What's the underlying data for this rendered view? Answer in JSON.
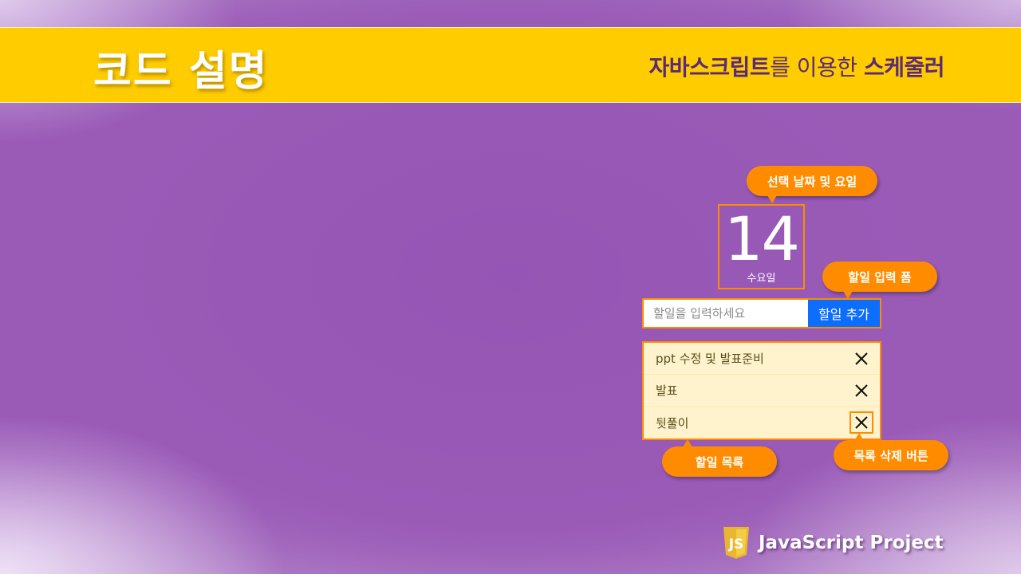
{
  "header": {
    "title": "코드 설명",
    "subtitle_part1": "자바스크립트",
    "subtitle_part2": "를 이용한 ",
    "subtitle_part3": "스케줄러"
  },
  "callouts": {
    "date": "선택 날짜 및 요일",
    "form": "할일 입력 폼",
    "list": "할일 목록",
    "delete": "목록 삭제 버튼"
  },
  "date": {
    "number": "14",
    "weekday": "수요일"
  },
  "form": {
    "placeholder": "할일을 입력하세요",
    "add_label": "할일 추가"
  },
  "todos": [
    {
      "text": "ppt 수정 및 발표준비"
    },
    {
      "text": "발표"
    },
    {
      "text": "뒷풀이"
    }
  ],
  "footer": {
    "logo_text": "JS",
    "label": "JavaScript Project"
  },
  "colors": {
    "background": "#9a5bb7",
    "header": "#ffcc00",
    "accent": "#ff8c00",
    "button": "#0d6efd",
    "list_bg": "#fff3cd"
  }
}
